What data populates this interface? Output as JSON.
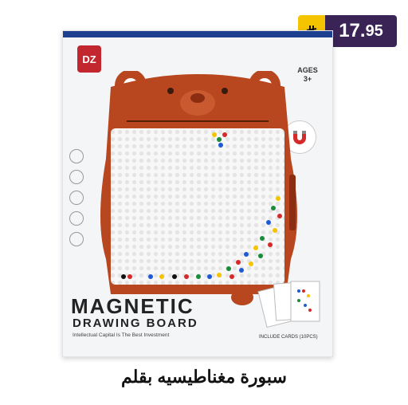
{
  "price": {
    "integer": "17.",
    "decimals": "95",
    "currency_icon": "riyal-icon"
  },
  "box": {
    "brand_logo_text": "DZ",
    "ages_label": "AGES",
    "ages_value": "3+",
    "title_line1": "MAGNETIC",
    "title_line2": "DRAWING BOARD",
    "tagline": "Intellectual Capital Is The Best Investment",
    "cards_caption": "INCLUDE CARDS (10PCS)"
  },
  "caption": "سبورة مغناطيسيه بقلم",
  "colors": {
    "badge_bg": "#3a2456",
    "currency_bg": "#f5c400",
    "bear": "#b8461f",
    "box_band": "#1c3f8f"
  }
}
